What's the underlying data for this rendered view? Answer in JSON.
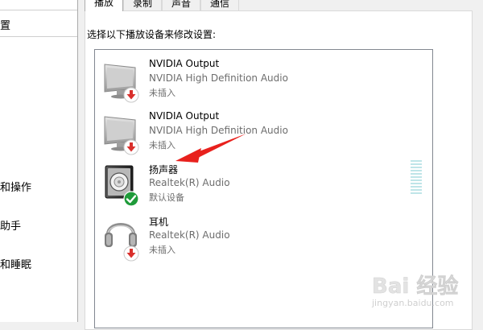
{
  "background_window": {
    "search_fragment": "置",
    "items": [
      "和操作",
      "助手",
      "和睡眠"
    ]
  },
  "sound_dialog": {
    "tabs": [
      {
        "label": "播放",
        "active": true
      },
      {
        "label": "录制",
        "active": false
      },
      {
        "label": "声音",
        "active": false
      },
      {
        "label": "通信",
        "active": false
      }
    ],
    "instruction": "选择以下播放设备来修改设置:",
    "devices": [
      {
        "name": "NVIDIA Output",
        "description": "NVIDIA High Definition Audio",
        "status": "未插入",
        "icon": "monitor-icon",
        "badge": "unplugged-badge-icon"
      },
      {
        "name": "NVIDIA Output",
        "description": "NVIDIA High Definition Audio",
        "status": "未插入",
        "icon": "monitor-icon",
        "badge": "unplugged-badge-icon"
      },
      {
        "name": "扬声器",
        "description": "Realtek(R) Audio",
        "status": "默认设备",
        "icon": "speaker-icon",
        "badge": "default-check-badge-icon"
      },
      {
        "name": "耳机",
        "description": "Realtek(R) Audio",
        "status": "未插入",
        "icon": "headphones-icon",
        "badge": "unplugged-badge-icon"
      }
    ],
    "volume_meter_level": 0
  },
  "colors": {
    "unplugged_badge": "#d9302c",
    "default_badge": "#1f9b3a",
    "annotation_arrow": "#e8211d",
    "meter_segment": "#bfe5e8"
  },
  "watermark": {
    "text": "Bai 经验",
    "url": "jingyan.baidu.com"
  }
}
